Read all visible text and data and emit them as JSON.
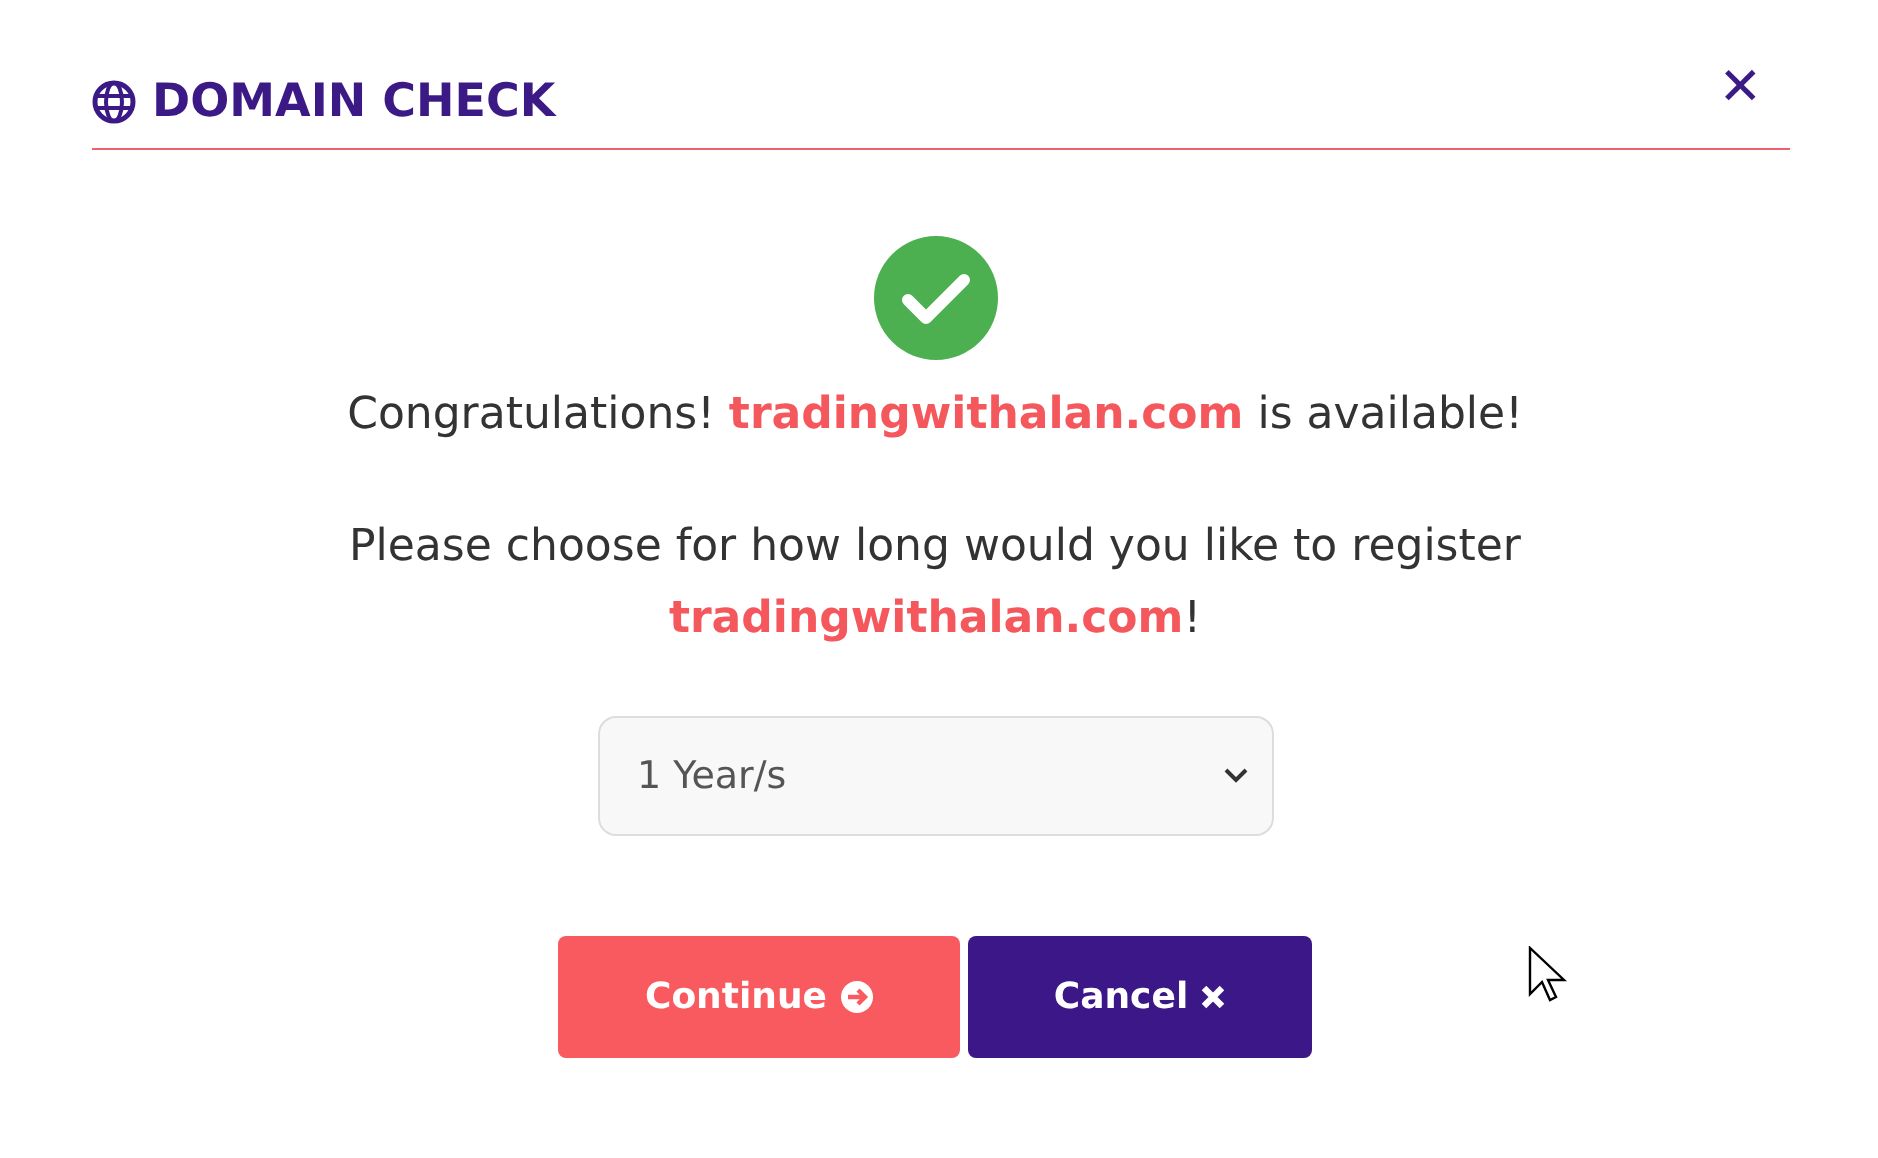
{
  "dialog": {
    "title": "DOMAIN CHECK",
    "close": "✕",
    "message": "Congratulations! **tradingwithalan.com** is available!",
    "prompt": "Please choose for how long would you like to register **tradingwithalan.com**!",
    "period_select": {
      "value": "1 Year/s"
    },
    "buttons": [
      {
        "label": "Continue",
        "kind": "primary"
      },
      {
        "label": "Cancel",
        "kind": "secondary"
      }
    ]
  }
}
